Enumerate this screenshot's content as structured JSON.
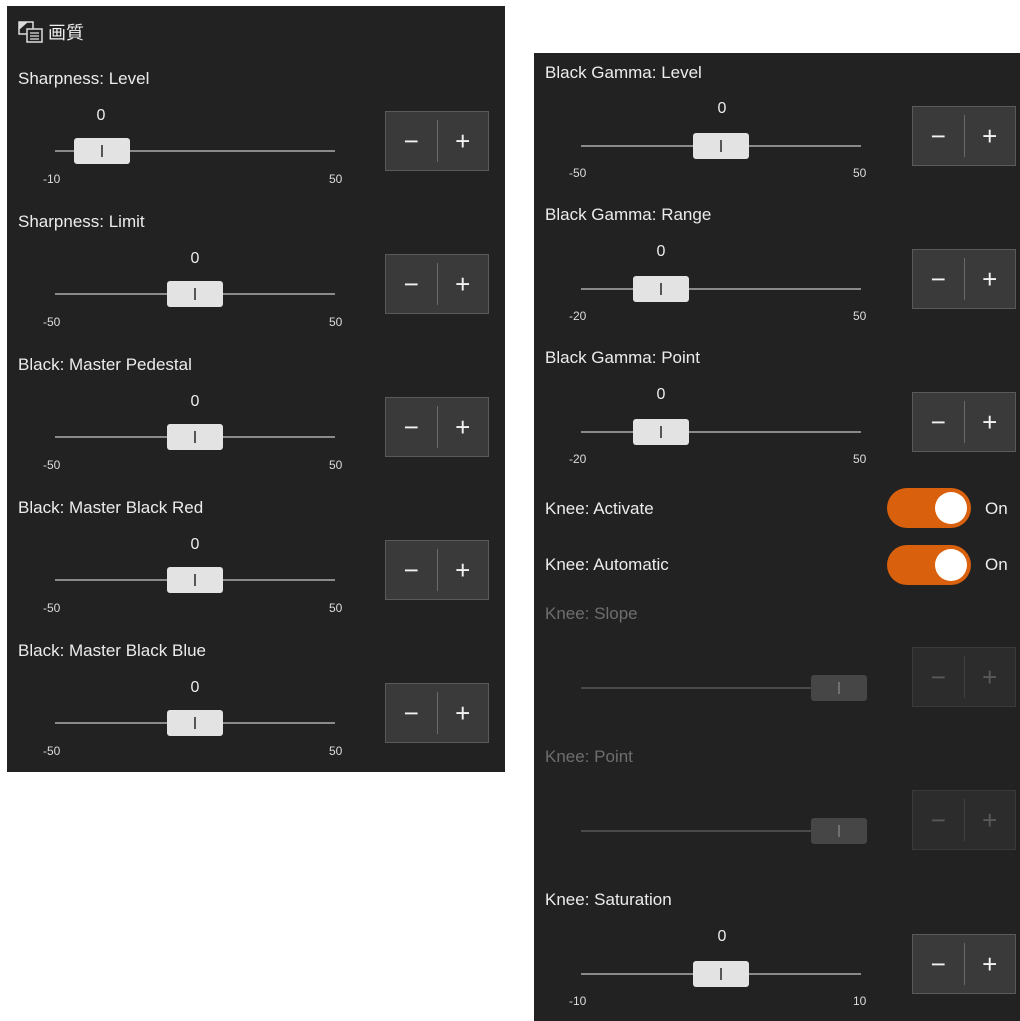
{
  "left_panel": {
    "title": "画質",
    "rows": [
      {
        "label": "Sharpness: Level",
        "value": "0",
        "min": "-10",
        "max": "50",
        "level": 0.167
      },
      {
        "label": "Sharpness: Limit",
        "value": "0",
        "min": "-50",
        "max": "50",
        "level": 0.5
      },
      {
        "label": "Black: Master Pedestal",
        "value": "0",
        "min": "-50",
        "max": "50",
        "level": 0.5
      },
      {
        "label": "Black: Master Black Red",
        "value": "0",
        "min": "-50",
        "max": "50",
        "level": 0.5
      },
      {
        "label": "Black: Master Black Blue",
        "value": "0",
        "min": "-50",
        "max": "50",
        "level": 0.5
      }
    ]
  },
  "right_panel": {
    "black_gamma_level": {
      "label": "Black Gamma: Level",
      "value": "0",
      "min": "-50",
      "max": "50",
      "level": 0.5
    },
    "black_gamma_range": {
      "label": "Black Gamma: Range",
      "value": "0",
      "min": "-20",
      "max": "50",
      "level": 0.286
    },
    "black_gamma_point": {
      "label": "Black Gamma: Point",
      "value": "0",
      "min": "-20",
      "max": "50",
      "level": 0.286
    },
    "knee_activate": {
      "label": "Knee: Activate",
      "state": "On"
    },
    "knee_automatic": {
      "label": "Knee: Automatic",
      "state": "On"
    },
    "knee_slope": {
      "label": "Knee: Slope",
      "level": 1.0
    },
    "knee_point": {
      "label": "Knee: Point",
      "level": 1.0
    },
    "knee_saturation": {
      "label": "Knee: Saturation",
      "value": "0",
      "min": "-10",
      "max": "10",
      "level": 0.5
    }
  },
  "stepper": {
    "minus": "−",
    "plus": "+"
  },
  "colors": {
    "panel_bg": "#222222",
    "toggle_on": "#d9600d",
    "thumb": "#e3e3e3"
  },
  "icons": {
    "header": "picture-settings-icon",
    "thumb": "slider-grip-icon"
  }
}
